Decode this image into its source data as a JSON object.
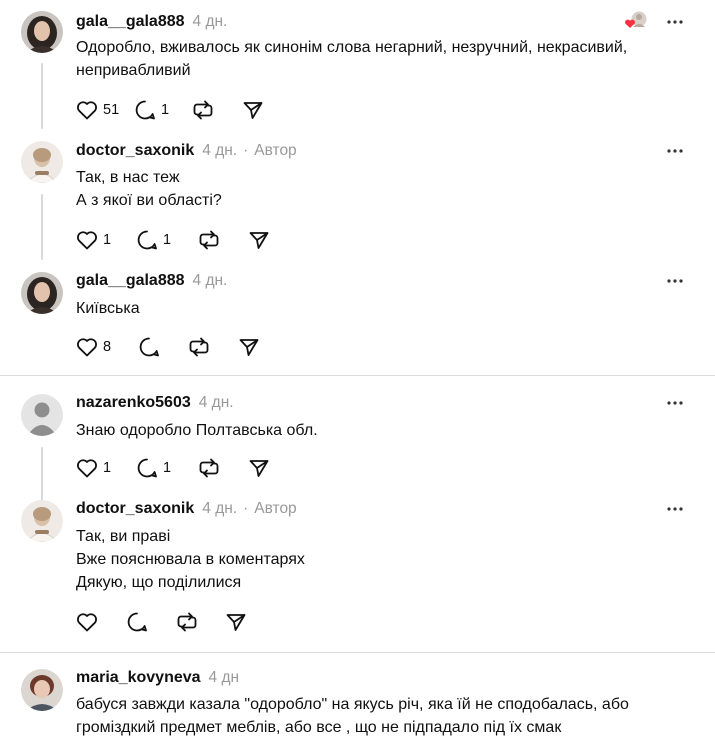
{
  "posts": [
    {
      "username": "gala__gala888",
      "time": "4 дн.",
      "is_author": false,
      "lines": [
        "Одоробло, вживалось як синонім слова негарний, незручний, некрасивий,",
        "непривабливий"
      ],
      "likes": "51",
      "replies": "1",
      "avatar": "avatar-woman-dark-hair",
      "liked_by_author_badge": true,
      "threaded": true
    },
    {
      "username": "doctor_saxonik",
      "time": "4 дн.",
      "is_author": true,
      "author_label": "Автор",
      "lines": [
        "Так, в нас теж",
        "А з якої ви області?"
      ],
      "likes": "1",
      "replies": "1",
      "avatar": "avatar-woman-light",
      "threaded": true
    },
    {
      "username": "gala__gala888",
      "time": "4 дн.",
      "is_author": false,
      "lines": [
        "Київська"
      ],
      "likes": "8",
      "replies": "",
      "avatar": "avatar-woman-dark-hair",
      "threaded": false
    },
    {
      "username": "nazarenko5603",
      "time": "4 дн.",
      "is_author": false,
      "lines": [
        "Знаю одоробло Полтавська обл."
      ],
      "likes": "1",
      "replies": "1",
      "avatar": "avatar-default-person",
      "threaded": true
    },
    {
      "username": "doctor_saxonik",
      "time": "4 дн.",
      "is_author": true,
      "author_label": "Автор",
      "lines": [
        "Так, ви праві",
        "Вже пояснювала в коментарях",
        "Дякую, що поділилися"
      ],
      "likes": "",
      "replies": "",
      "avatar": "avatar-woman-light",
      "threaded": false
    },
    {
      "username": "maria_kovyneva",
      "time": "4 дн",
      "is_author": false,
      "lines": [
        "бабуся завжди казала \"одоробло\" на якусь річ, яка їй не сподобалась, або",
        "громіздкий предмет меблів, або все , що не підпадало під їх смак"
      ],
      "likes": "",
      "replies": "",
      "avatar": "avatar-woman-short-hair",
      "threaded": false
    }
  ],
  "icons": {
    "like": "heart-icon",
    "reply": "comment-icon",
    "repost": "repost-icon",
    "share": "send-icon",
    "more": "more-icon"
  },
  "colors": {
    "text": "#101010",
    "muted": "#999999",
    "divider": "#dcdcdc",
    "thread_line": "#d9d9d9",
    "like_badge_heart": "#ff3040"
  }
}
